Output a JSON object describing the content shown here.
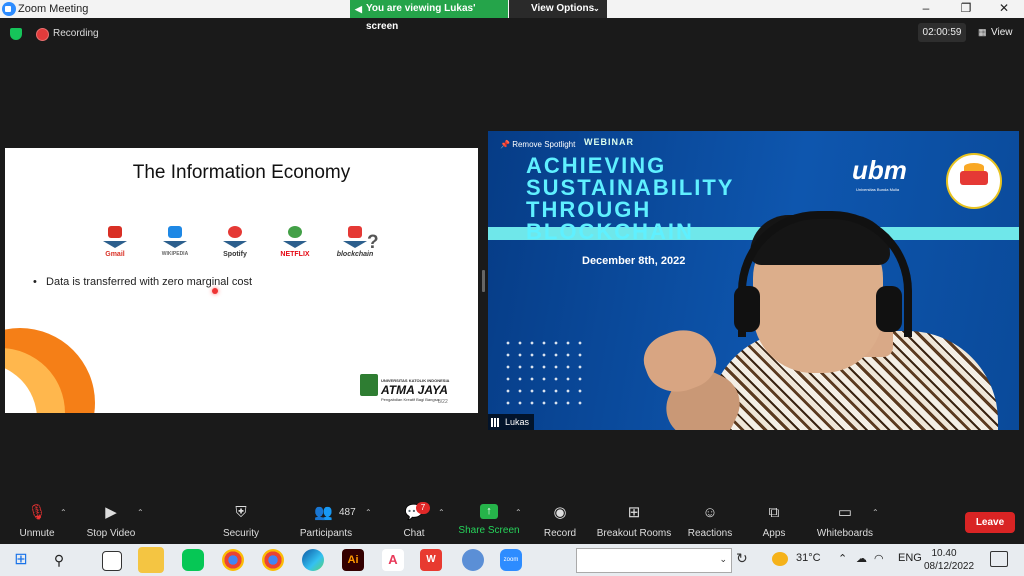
{
  "window": {
    "title": "Zoom Meeting"
  },
  "banner": {
    "viewing": "You are viewing Lukas' screen",
    "view_options": "View Options"
  },
  "status": {
    "recording": "Recording",
    "timer": "02:00:59",
    "view": "View"
  },
  "slide": {
    "title": "The Information Economy",
    "logos": [
      {
        "name": "gmail",
        "label": "Gmail",
        "color": "#d93025"
      },
      {
        "name": "wikipedia",
        "label": "WIKIPEDIA",
        "color": "#666666"
      },
      {
        "name": "spotify",
        "label": "Spotify",
        "color": "#1db954"
      },
      {
        "name": "netflix",
        "label": "NETFLIX",
        "color": "#e50914"
      },
      {
        "name": "blockchain",
        "label": "blockchain",
        "color": "#f7931a"
      }
    ],
    "question_mark": "?",
    "bullet": "Data is transferred with zero marginal cost",
    "footer_top": "UNIVERSITAS KATOLIK INDONESIA",
    "footer_name": "ATMA JAYA",
    "footer_sub": "Pengabdian Kreatif Bagi Bangsa",
    "slide_number": "8/22"
  },
  "video": {
    "spotlight": "Remove Spotlight",
    "webinar": "WEBINAR",
    "lines": [
      "ACHIEVING",
      "SUSTAINABILITY",
      "THROUGH",
      "BLOCKCHAIN"
    ],
    "date": "December 8th, 2022",
    "ubm": "ubm",
    "ubm_sub": "Universitas Bunda Mulia",
    "name": "Lukas"
  },
  "toolbar": {
    "unmute": "Unmute",
    "stop_video": "Stop Video",
    "security": "Security",
    "participants": "Participants",
    "participants_count": "487",
    "chat": "Chat",
    "chat_badge": "7",
    "share_screen": "Share Screen",
    "record": "Record",
    "breakout": "Breakout Rooms",
    "reactions": "Reactions",
    "apps": "Apps",
    "whiteboards": "Whiteboards",
    "leave": "Leave"
  },
  "taskbar": {
    "temp": "31°C",
    "lang": "ENG",
    "time": "10.40",
    "date": "08/12/2022"
  },
  "colors": {
    "zoom_blue": "#2d8cff",
    "green": "#25a44a",
    "leave_red": "#d92424",
    "video_cyan": "#5ff0ff"
  }
}
